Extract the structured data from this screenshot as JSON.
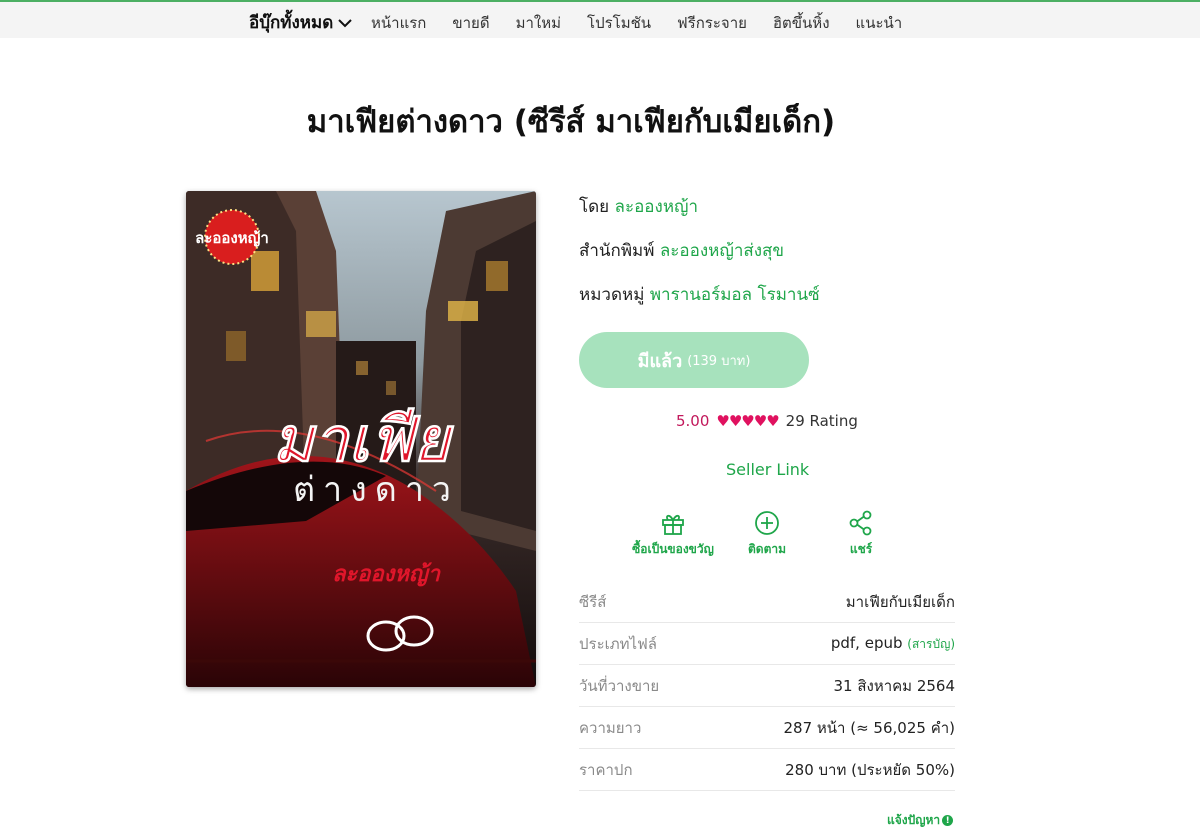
{
  "nav": {
    "all_label": "อีบุ๊กทั้งหมด",
    "items": [
      "หน้าแรก",
      "ขายดี",
      "มาใหม่",
      "โปรโมชัน",
      "ฟรีกระจาย",
      "ฮิตขึ้นหิ้ง",
      "แนะนำ"
    ]
  },
  "book": {
    "title": "มาเฟียต่างดาว (ซีรีส์ มาเฟียกับเมียเด็ก)",
    "cover": {
      "publisher_logo": "ละอองหญ้า",
      "title_line1": "มาเฟีย",
      "title_line2": "ต่างดาว",
      "author_signature": "ละอองหญ้า"
    },
    "author_label": "โดย",
    "author": "ละอองหญ้า",
    "publisher_label": "สำนักพิมพ์",
    "publisher": "ละอองหญ้าส่งสุข",
    "category_label": "หมวดหมู่",
    "category": "พารานอร์มอล โรมานซ์"
  },
  "purchase": {
    "owned_label": "มีแล้ว",
    "price_note": "(139 บาท)"
  },
  "rating": {
    "score": "5.00",
    "stars": 5,
    "count_text": "29 Rating"
  },
  "seller_link": "Seller Link",
  "actions": {
    "gift": "ซื้อเป็นของขวัญ",
    "follow": "ติดตาม",
    "share": "แชร์"
  },
  "info": [
    {
      "key": "ซีรีส์",
      "value": "มาเฟียกับเมียเด็ก"
    },
    {
      "key": "ประเภทไฟล์",
      "value": "pdf, epub",
      "extra": "(สารบัญ)"
    },
    {
      "key": "วันที่วางขาย",
      "value": "31 สิงหาคม 2564"
    },
    {
      "key": "ความยาว",
      "value": "287 หน้า (≈ 56,025 คำ)"
    },
    {
      "key": "ราคาปก",
      "value": "280 บาท (ประหยัด 50%)"
    }
  ],
  "report": "แจ้งปัญหา",
  "colors": {
    "accent": "#1fa64a",
    "owned_button": "#a7e2bd",
    "rating": "#e0115f",
    "nav_bg": "#f4f4f4"
  }
}
